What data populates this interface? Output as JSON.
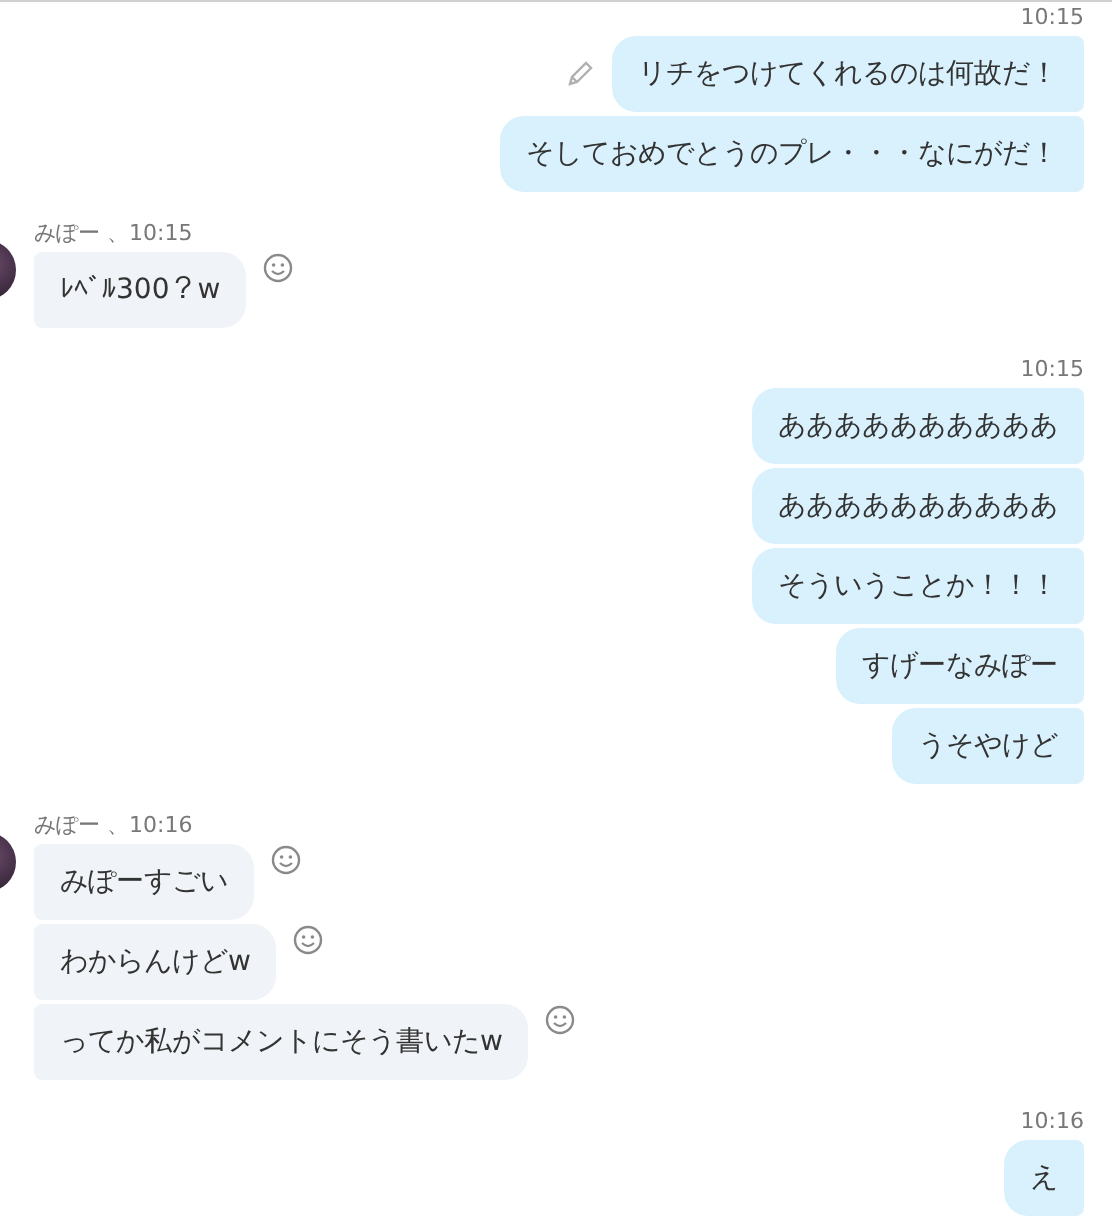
{
  "groups": [
    {
      "kind": "outgoing",
      "time": "10:15",
      "messages": [
        {
          "text": "リチをつけてくれるのは何故だ！",
          "edited": true
        },
        {
          "text": "そしておめでとうのプレ・・・なにがだ！",
          "edited": false
        }
      ]
    },
    {
      "kind": "incoming",
      "sender": "みぽー 、10:15",
      "messages": [
        {
          "text": "ﾚﾍﾞﾙ300？w"
        }
      ]
    },
    {
      "kind": "outgoing",
      "time": "10:15",
      "messages": [
        {
          "text": "ああああああああああ",
          "edited": false
        },
        {
          "text": "ああああああああああ",
          "edited": false
        },
        {
          "text": "そういうことか！！！",
          "edited": false
        },
        {
          "text": "すげーなみぽー",
          "edited": false
        },
        {
          "text": "うそやけど",
          "edited": false
        }
      ]
    },
    {
      "kind": "incoming",
      "sender": "みぽー 、10:16",
      "messages": [
        {
          "text": "みぽーすごい"
        },
        {
          "text": "わからんけどw"
        },
        {
          "text": "ってか私がコメントにそう書いたw"
        }
      ]
    },
    {
      "kind": "outgoing",
      "time": "10:16",
      "messages": [
        {
          "text": "え",
          "edited": false
        }
      ]
    }
  ]
}
